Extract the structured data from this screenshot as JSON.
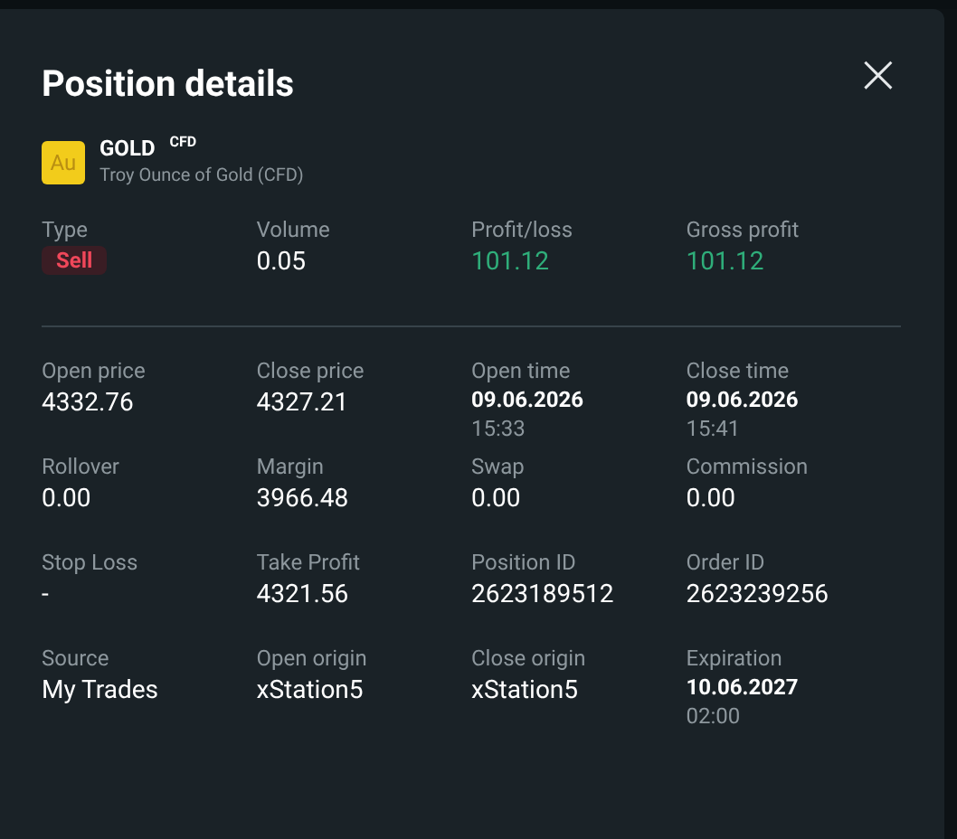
{
  "dialog": {
    "title": "Position details",
    "close": "×"
  },
  "instrument": {
    "logo": "Au",
    "symbol": "GOLD",
    "tag": "CFD",
    "description": "Troy Ounce of Gold (CFD)"
  },
  "summary": [
    {
      "label": "Type",
      "value": "Sell",
      "kind": "badge"
    },
    {
      "label": "Volume",
      "value": "0.05",
      "kind": "plain"
    },
    {
      "label": "Profit/loss",
      "value": "101.12",
      "kind": "positive"
    },
    {
      "label": "Gross profit",
      "value": "101.12",
      "kind": "positive"
    }
  ],
  "details": [
    {
      "label": "Open price",
      "value": "4332.76",
      "kind": "plain"
    },
    {
      "label": "Close price",
      "value": "4327.21",
      "kind": "plain"
    },
    {
      "label": "Open time",
      "value": "09.06.2026",
      "time": "15:33",
      "kind": "datetime"
    },
    {
      "label": "Close time",
      "value": "09.06.2026",
      "time": "15:41",
      "kind": "datetime"
    },
    {
      "label": "Rollover",
      "value": "0.00",
      "kind": "plain"
    },
    {
      "label": "Margin",
      "value": "3966.48",
      "kind": "plain"
    },
    {
      "label": "Swap",
      "value": "0.00",
      "kind": "plain"
    },
    {
      "label": "Commission",
      "value": "0.00",
      "kind": "plain"
    },
    {
      "label": "Stop Loss",
      "value": "-",
      "kind": "plain"
    },
    {
      "label": "Take Profit",
      "value": "4321.56",
      "kind": "plain"
    },
    {
      "label": "Position ID",
      "value": "2623189512",
      "kind": "plain"
    },
    {
      "label": "Order ID",
      "value": "2623239256",
      "kind": "plain"
    },
    {
      "label": "Source",
      "value": "My Trades",
      "kind": "plain"
    },
    {
      "label": "Open origin",
      "value": "xStation5",
      "kind": "plain"
    },
    {
      "label": "Close origin",
      "value": "xStation5",
      "kind": "plain"
    },
    {
      "label": "Expiration",
      "value": "10.06.2027",
      "time": "02:00",
      "kind": "datetime"
    }
  ]
}
